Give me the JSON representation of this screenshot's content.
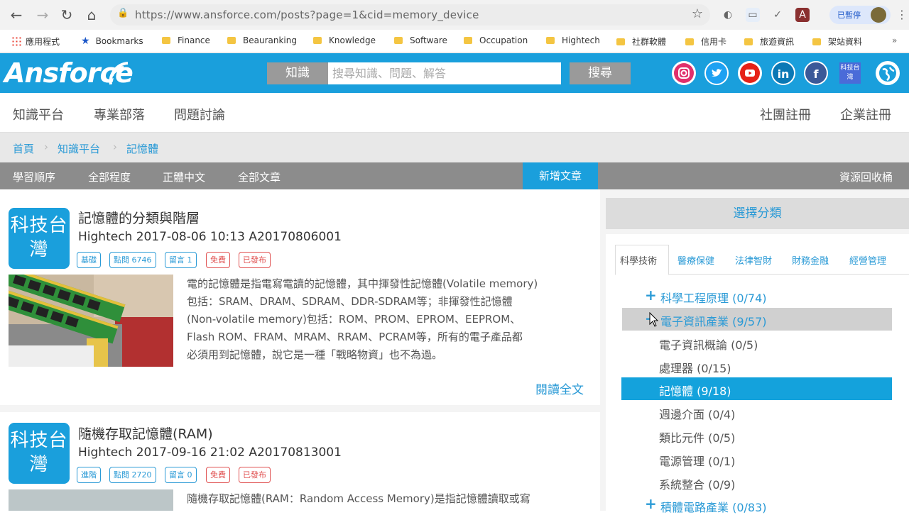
{
  "browser": {
    "url": "https://www.ansforce.com/posts?page=1&cid=memory_device",
    "paused_label": "已暫停"
  },
  "bookmarks": [
    {
      "label": "應用程式",
      "icon": "apps-grid-icon"
    },
    {
      "label": "Bookmarks",
      "icon": "star-icon"
    },
    {
      "label": "Finance",
      "icon": "folder-icon"
    },
    {
      "label": "Beauranking",
      "icon": "folder-icon"
    },
    {
      "label": "Knowledge",
      "icon": "folder-icon"
    },
    {
      "label": "Software",
      "icon": "folder-icon"
    },
    {
      "label": "Occupation",
      "icon": "folder-icon"
    },
    {
      "label": "Hightech",
      "icon": "folder-icon"
    },
    {
      "label": "社群軟體",
      "icon": "folder-icon"
    },
    {
      "label": "信用卡",
      "icon": "folder-icon"
    },
    {
      "label": "旅遊資訊",
      "icon": "folder-icon"
    },
    {
      "label": "架站資料",
      "icon": "folder-icon"
    }
  ],
  "header": {
    "logo": "Ansforce",
    "search_category": "知識",
    "search_placeholder": "搜尋知識、問題、解答",
    "search_button": "搜尋",
    "brand_tile": "科技台灣",
    "social": {
      "linkedin": "in",
      "facebook": "f"
    }
  },
  "main_nav": {
    "left": [
      "知識平台",
      "專業部落",
      "問題討論"
    ],
    "right": [
      "社團註冊",
      "企業註冊"
    ]
  },
  "breadcrumb": [
    "首頁",
    "知識平台",
    "記憶體"
  ],
  "sub_nav": {
    "items": [
      "學習順序",
      "全部程度",
      "正體中文",
      "全部文章"
    ],
    "new_post": "新增文章",
    "recycle": "資源回收桶"
  },
  "articles": [
    {
      "badge": "科技台灣",
      "title": "記憶體的分類與階層",
      "meta": "Hightech  2017-08-06 10:13  A20170806001",
      "tags": [
        {
          "label": "基礎",
          "color": "blue"
        },
        {
          "label": "點閱 6746",
          "color": "blue"
        },
        {
          "label": "留言 1",
          "color": "blue"
        },
        {
          "label": "免費",
          "color": "red"
        },
        {
          "label": "已發布",
          "color": "red"
        }
      ],
      "body_lines": [
        "電的記憶體是指電寫電讀的記憶體，其中揮發性記憶體(Volatile memory)",
        "包括：SRAM、DRAM、SDRAM、DDR-SDRAM等；非揮發性記憶體",
        "(Non-volatile memory)包括：ROM、PROM、EPROM、EEPROM、",
        "Flash ROM、FRAM、MRAM、RRAM、PCRAM等，所有的電子產品都",
        "必須用到記憶體，說它是一種「戰略物資」也不為過。"
      ],
      "read_more": "閱讀全文"
    },
    {
      "badge": "科技台灣",
      "title": "隨機存取記憶體(RAM)",
      "meta": "Hightech  2017-09-16 21:02  A20170813001",
      "tags": [
        {
          "label": "進階",
          "color": "blue"
        },
        {
          "label": "點閱 2720",
          "color": "blue"
        },
        {
          "label": "留言 0",
          "color": "blue"
        },
        {
          "label": "免費",
          "color": "red"
        },
        {
          "label": "已發布",
          "color": "red"
        }
      ],
      "body_lines": [
        "隨機存取記憶體(RAM：Random Access Memory)是指記憶體讀取或寫"
      ]
    }
  ],
  "sidebar": {
    "title": "選擇分類",
    "tabs": [
      "科學技術",
      "醫療保健",
      "法律智財",
      "財務金融",
      "經營管理"
    ],
    "categories": [
      {
        "label": "科學工程原理 (0/74)",
        "type": "parent",
        "marker": "+"
      },
      {
        "label": "電子資訊產業 (9/57)",
        "type": "parent-open",
        "marker": "−"
      },
      {
        "label": "電子資訊概論 (0/5)",
        "type": "child"
      },
      {
        "label": "處理器 (0/15)",
        "type": "child"
      },
      {
        "label": "記憶體 (9/18)",
        "type": "selected"
      },
      {
        "label": "週邊介面 (0/4)",
        "type": "child"
      },
      {
        "label": "類比元件 (0/5)",
        "type": "child"
      },
      {
        "label": "電源管理 (0/1)",
        "type": "child"
      },
      {
        "label": "系統整合 (0/9)",
        "type": "child"
      },
      {
        "label": "積體電路產業 (0/83)",
        "type": "parent",
        "marker": "+"
      }
    ]
  }
}
